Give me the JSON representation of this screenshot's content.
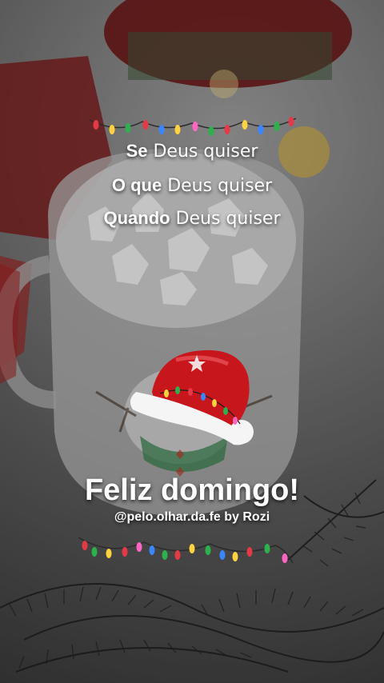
{
  "captions": {
    "line1_bold": "Se",
    "line1_light": "Deus quiser",
    "line2_bold": "O que",
    "line2_light": "Deus quiser",
    "line3_bold": "Quando",
    "line3_light": "Deus quiser"
  },
  "greeting": "Feliz domingo!",
  "handle": "@pelo.olhar.da.fe by Rozi",
  "colors": {
    "text": "#ffffff",
    "santa_hat": "#c8161d",
    "lights": [
      "#e63946",
      "#2bb24c",
      "#ffd23f",
      "#3a86ff",
      "#ff66c4"
    ]
  },
  "icons": {
    "top_string": "christmas-lights-icon",
    "bottom_string": "christmas-lights-icon",
    "hat": "santa-hat-icon"
  }
}
